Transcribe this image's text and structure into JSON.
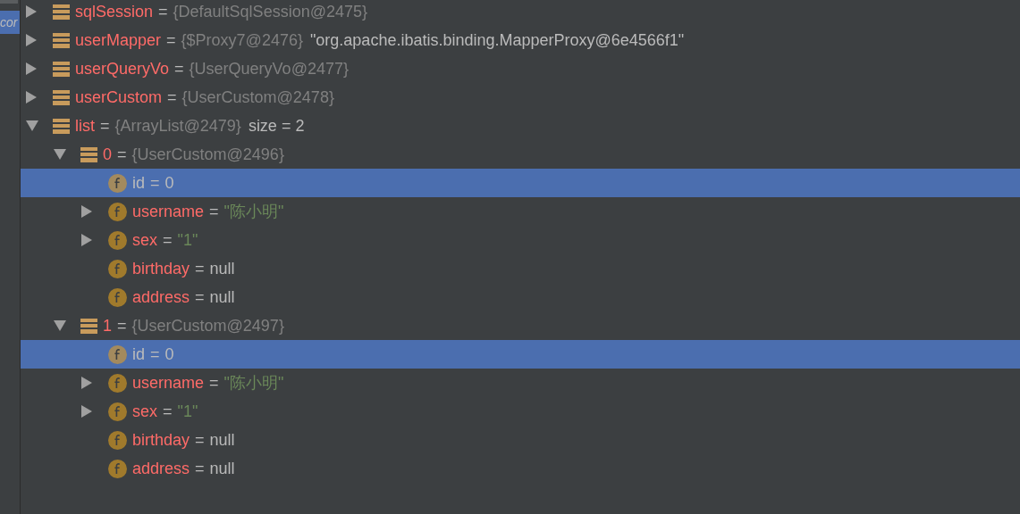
{
  "side_panel": {
    "items": [
      {
        "label": "cor",
        "selected": true
      }
    ]
  },
  "variables": [
    {
      "name": "sqlSession",
      "kind": "object",
      "equals": "=",
      "ref": "{DefaultSqlSession@2475}",
      "expanded": false,
      "selected": false
    },
    {
      "name": "userMapper",
      "kind": "object",
      "equals": "=",
      "ref": "{$Proxy7@2476}",
      "value": "\"org.apache.ibatis.binding.MapperProxy@6e4566f1\"",
      "expanded": false,
      "selected": false
    },
    {
      "name": "userQueryVo",
      "kind": "object",
      "equals": "=",
      "ref": "{UserQueryVo@2477}",
      "expanded": false,
      "selected": false
    },
    {
      "name": "userCustom",
      "kind": "object",
      "equals": "=",
      "ref": "{UserCustom@2478}",
      "expanded": false,
      "selected": false
    },
    {
      "name": "list",
      "kind": "object",
      "equals": "=",
      "ref": "{ArrayList@2479}",
      "value": "size = 2",
      "expanded": true,
      "selected": false,
      "children": [
        {
          "name": "0",
          "kind": "object",
          "equals": "=",
          "ref": "{UserCustom@2496}",
          "expanded": true,
          "selected": false,
          "children": [
            {
              "name": "id",
              "kind": "field",
              "equals": "=",
              "value": "0",
              "selected": true
            },
            {
              "name": "username",
              "kind": "field",
              "equals": "=",
              "string": "\"陈小明\"",
              "expanded": false,
              "selected": false
            },
            {
              "name": "sex",
              "kind": "field",
              "equals": "=",
              "string": "\"1\"",
              "expanded": false,
              "selected": false
            },
            {
              "name": "birthday",
              "kind": "field",
              "equals": "=",
              "value": "null",
              "selected": false
            },
            {
              "name": "address",
              "kind": "field",
              "equals": "=",
              "value": "null",
              "selected": false
            }
          ]
        },
        {
          "name": "1",
          "kind": "object",
          "equals": "=",
          "ref": "{UserCustom@2497}",
          "expanded": true,
          "selected": false,
          "children": [
            {
              "name": "id",
              "kind": "field",
              "equals": "=",
              "value": "0",
              "selected": true
            },
            {
              "name": "username",
              "kind": "field",
              "equals": "=",
              "string": "\"陈小明\"",
              "expanded": false,
              "selected": false
            },
            {
              "name": "sex",
              "kind": "field",
              "equals": "=",
              "string": "\"1\"",
              "expanded": false,
              "selected": false
            },
            {
              "name": "birthday",
              "kind": "field",
              "equals": "=",
              "value": "null",
              "selected": false
            },
            {
              "name": "address",
              "kind": "field",
              "equals": "=",
              "value": "null",
              "selected": false
            }
          ]
        }
      ]
    }
  ]
}
